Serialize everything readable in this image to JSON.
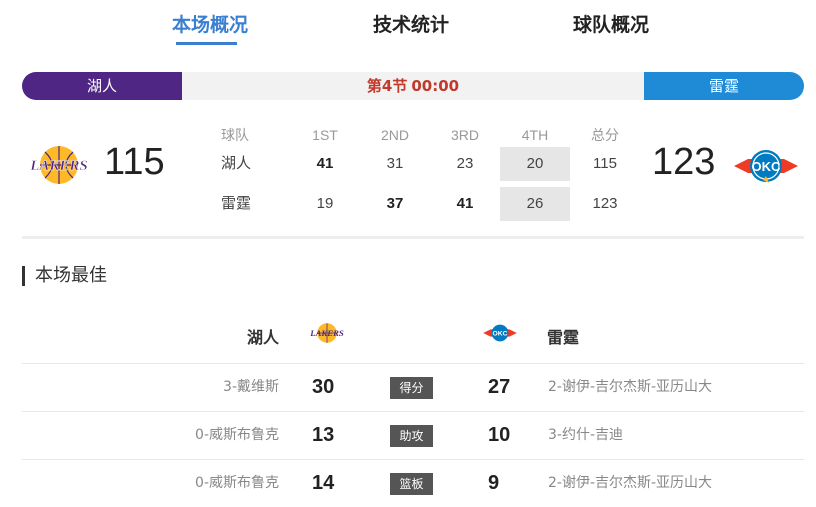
{
  "tabs": [
    {
      "label": "本场概况",
      "active": true
    },
    {
      "label": "技术统计",
      "active": false
    },
    {
      "label": "球队概况",
      "active": false
    }
  ],
  "game": {
    "home_team": "湖人",
    "away_team": "雷霆",
    "period": "第4节",
    "clock": "00:00",
    "home_score": "115",
    "away_score": "123",
    "home_color": "#4f2683",
    "away_color": "#1f8bd6"
  },
  "scoreboard": {
    "headers": [
      "球队",
      "1ST",
      "2ND",
      "3RD",
      "4TH",
      "总分"
    ],
    "rows": [
      {
        "team": "湖人",
        "q": [
          "41",
          "31",
          "23",
          "20"
        ],
        "total": "115"
      },
      {
        "team": "雷霆",
        "q": [
          "19",
          "37",
          "41",
          "26"
        ],
        "total": "123"
      }
    ]
  },
  "leaders": {
    "title": "本场最佳",
    "home_team": "湖人",
    "away_team": "雷霆",
    "rows": [
      {
        "home_player": "3-戴维斯",
        "home_value": "30",
        "stat": "得分",
        "away_value": "27",
        "away_player": "2-谢伊-吉尔杰斯-亚历山大"
      },
      {
        "home_player": "0-威斯布鲁克",
        "home_value": "13",
        "stat": "助攻",
        "away_value": "10",
        "away_player": "3-约什-吉迪"
      },
      {
        "home_player": "0-威斯布鲁克",
        "home_value": "14",
        "stat": "篮板",
        "away_value": "9",
        "away_player": "2-谢伊-吉尔杰斯-亚历山大"
      }
    ]
  },
  "icons": {
    "home_logo": "lakers-logo-icon",
    "away_logo": "okc-thunder-logo-icon"
  }
}
